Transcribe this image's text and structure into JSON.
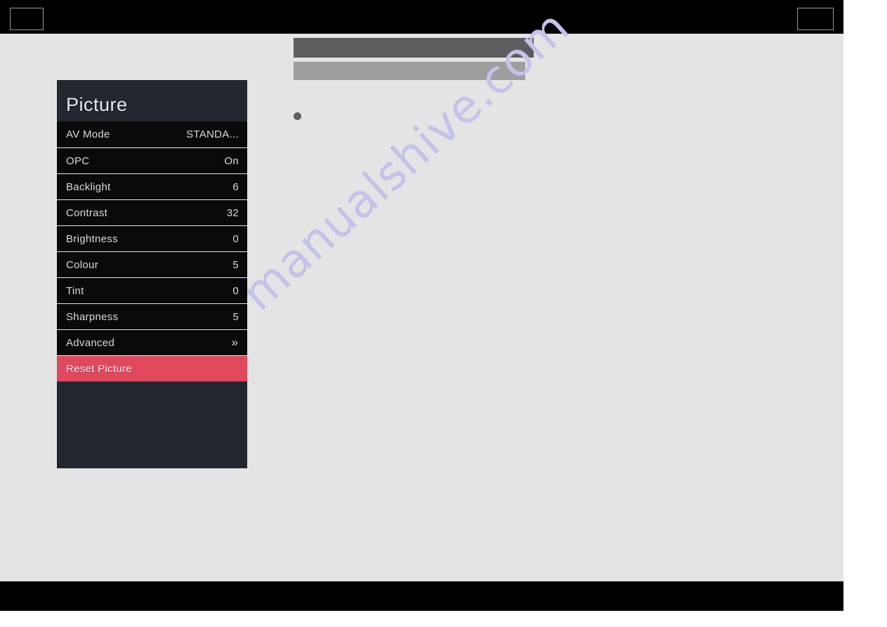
{
  "page": {
    "background_color": "#e4e4e4",
    "band_color": "#000000",
    "watermark_text": "manualshive.com",
    "watermark_color": "#c3c2e8"
  },
  "top_band": {
    "left_box_label": "",
    "right_box_label": ""
  },
  "bottom_band": {
    "label": ""
  },
  "placeholders": [
    {
      "name": "redacted-line-1",
      "color": "#5d5d5d"
    },
    {
      "name": "redacted-line-2",
      "color": "#9e9e9e"
    }
  ],
  "bullet": {
    "marker": "",
    "color": "#5f5f5f"
  },
  "osd": {
    "title": "Picture",
    "accent_color": "#e0495c",
    "panel_color": "#22262f",
    "row_color": "#0a0a0b",
    "rows": [
      {
        "label": "AV Mode",
        "value": "STANDA...",
        "type": "text",
        "highlight": false
      },
      {
        "label": "OPC",
        "value": "On",
        "type": "text",
        "highlight": false
      },
      {
        "label": "Backlight",
        "value": "6",
        "type": "number",
        "highlight": false
      },
      {
        "label": "Contrast",
        "value": "32",
        "type": "number",
        "highlight": false
      },
      {
        "label": "Brightness",
        "value": "0",
        "type": "number",
        "highlight": false
      },
      {
        "label": "Colour",
        "value": "5",
        "type": "number",
        "highlight": false
      },
      {
        "label": "Tint",
        "value": "0",
        "type": "number",
        "highlight": false
      },
      {
        "label": "Sharpness",
        "value": "5",
        "type": "number",
        "highlight": false
      },
      {
        "label": "Advanced",
        "value": "»",
        "type": "submenu",
        "highlight": false
      },
      {
        "label": "Reset Picture",
        "value": "",
        "type": "action",
        "highlight": true
      }
    ]
  }
}
